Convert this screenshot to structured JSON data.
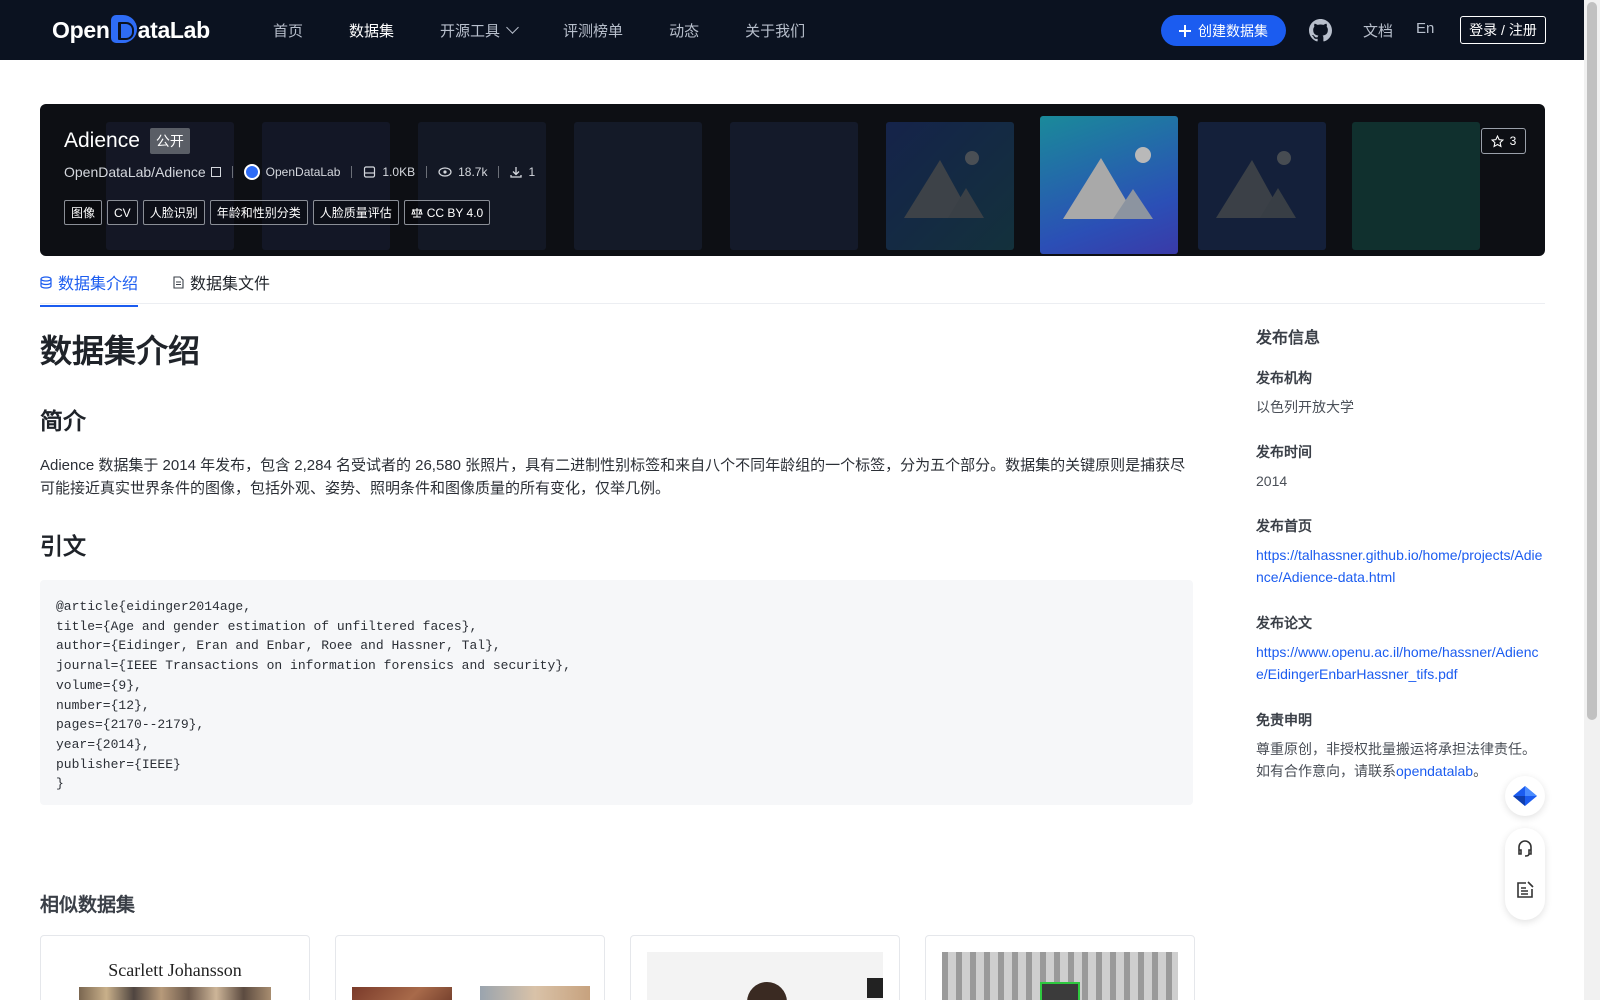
{
  "nav": {
    "logo": "OpenDataLab",
    "logo_pre": "Open",
    "logo_post": "ataLab",
    "items": [
      {
        "label": "首页"
      },
      {
        "label": "数据集"
      },
      {
        "label": "开源工具"
      },
      {
        "label": "评测榜单"
      },
      {
        "label": "动态"
      },
      {
        "label": "关于我们"
      }
    ],
    "create_button": "创建数据集",
    "docs": "文档",
    "lang": "En",
    "login": "登录 / 注册",
    "colors": {
      "bg": "#0b1220",
      "accent": "#1b5cf0"
    }
  },
  "dataset": {
    "name": "Adience",
    "visibility": "公开",
    "path": "OpenDataLab/Adience",
    "org": "OpenDataLab",
    "size": "1.0KB",
    "views": "18.7k",
    "downloads": "1",
    "tags": [
      "图像",
      "CV",
      "人脸识别",
      "年龄和性别分类",
      "人脸质量评估"
    ],
    "license": "CC BY 4.0",
    "stars": "3"
  },
  "tabs": [
    {
      "label": "数据集介绍"
    },
    {
      "label": "数据集文件"
    }
  ],
  "content": {
    "title": "数据集介绍",
    "intro_heading": "简介",
    "intro_text": "Adience 数据集于 2014 年发布，包含 2,284 名受试者的 26,580 张照片，具有二进制性别标签和来自八个不同年龄组的一个标签，分为五个部分。数据集的关键原则是捕获尽可能接近真实世界条件的图像，包括外观、姿势、照明条件和图像质量的所有变化，仅举几例。",
    "citation_heading": "引文",
    "citation_lines": [
      "@article{eidinger2014age,",
      "title={Age and gender estimation of unfiltered faces},",
      "author={Eidinger, Eran and Enbar, Roee and Hassner, Tal},",
      "journal={IEEE Transactions on information forensics and security},",
      "volume={9},",
      "number={12},",
      "pages={2170--2179},",
      "year={2014},",
      "publisher={IEEE}",
      "}"
    ],
    "similar_heading": "相似数据集",
    "similar_cards": [
      {
        "caption": "Scarlett Johansson"
      },
      {
        "caption": ""
      },
      {
        "caption": ""
      },
      {
        "caption": ""
      }
    ]
  },
  "sidebar": {
    "title": "发布信息",
    "org_label": "发布机构",
    "org_value": "以色列开放大学",
    "time_label": "发布时间",
    "time_value": "2014",
    "homepage_label": "发布首页",
    "homepage_value": "https://talhassner.github.io/home/projects/Adience/Adience-data.html",
    "paper_label": "发布论文",
    "paper_value": "https://www.openu.ac.il/home/hassner/Adience/EidingerEnbarHassner_tifs.pdf",
    "disclaimer_label": "免责申明",
    "disclaimer_text": "尊重原创，非授权批量搬运将承担法律责任。如有合作意向，请联系",
    "disclaimer_link": "opendatalab",
    "disclaimer_end": "。"
  }
}
